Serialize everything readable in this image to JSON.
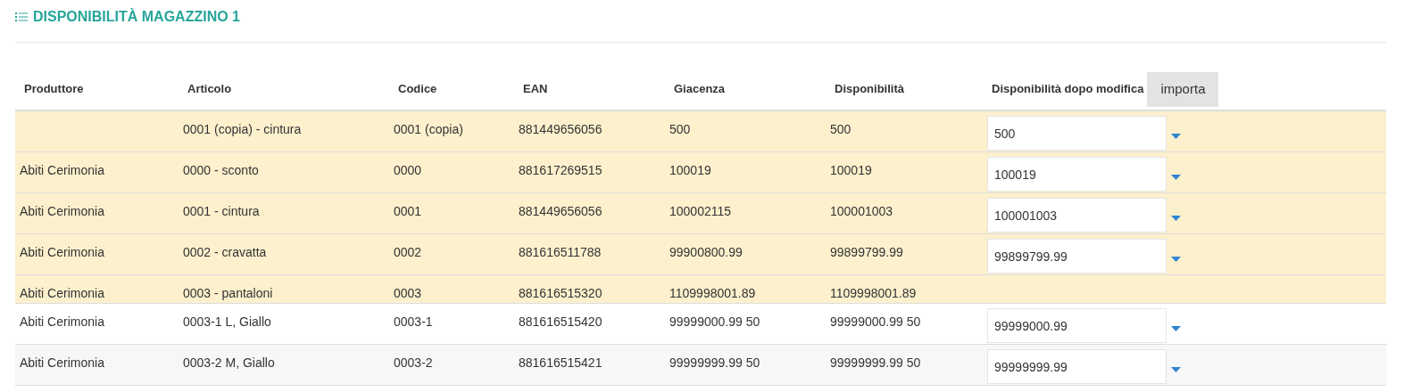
{
  "title": "DISPONIBILITÀ MAGAZZINO 1",
  "table": {
    "columns": [
      "Produttore",
      "Articolo",
      "Codice",
      "EAN",
      "Giacenza",
      "Disponibilità",
      "Disponibilità dopo modifica"
    ],
    "import_button": "importa",
    "rows": [
      {
        "highlighted": true,
        "cells": [
          "",
          "0001 (copia) - cintura",
          "0001 (copia)",
          "881449656056",
          "500",
          "500"
        ],
        "field": {
          "value": "500"
        }
      },
      {
        "highlighted": true,
        "cells": [
          "Abiti Cerimonia",
          "0000 - sconto",
          "0000",
          "881617269515",
          "100019",
          "100019"
        ],
        "field": {
          "value": "100019"
        }
      },
      {
        "highlighted": true,
        "cells": [
          "Abiti Cerimonia",
          "0001 - cintura",
          "0001",
          "881449656056",
          "100002115",
          "100001003"
        ],
        "field": {
          "value": "100001003"
        }
      },
      {
        "highlighted": true,
        "cells": [
          "Abiti Cerimonia",
          "0002 - cravatta",
          "0002",
          "881616511788",
          "99900800.99",
          "99899799.99"
        ],
        "field": {
          "value": "99899799.99"
        }
      },
      {
        "highlighted": true,
        "cells": [
          "Abiti Cerimonia",
          "0003 - pantaloni",
          "0003",
          "881616515320",
          "1109998001.89",
          "1109998001.89"
        ]
      },
      {
        "highlighted": false,
        "cells": [
          "Abiti Cerimonia",
          "0003-1 L, Giallo",
          "0003-1",
          "881616515420",
          "99999000.99 50",
          "99999000.99 50"
        ],
        "field": {
          "value": "99999000.99"
        }
      },
      {
        "highlighted": false,
        "cells": [
          "Abiti Cerimonia",
          "0003-2 M, Giallo",
          "0003-2",
          "881616515421",
          "99999999.99 50",
          "99999999.99 50"
        ],
        "field": {
          "value": "99999999.99"
        }
      }
    ]
  }
}
